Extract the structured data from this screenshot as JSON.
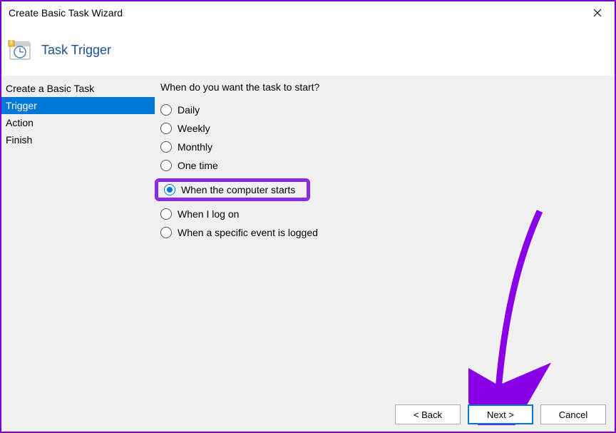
{
  "window": {
    "title": "Create Basic Task Wizard"
  },
  "header": {
    "title": "Task Trigger"
  },
  "sidebar": {
    "items": [
      {
        "label": "Create a Basic Task",
        "active": false
      },
      {
        "label": "Trigger",
        "active": true
      },
      {
        "label": "Action",
        "active": false
      },
      {
        "label": "Finish",
        "active": false
      }
    ]
  },
  "main": {
    "question": "When do you want the task to start?",
    "options": [
      {
        "label": "Daily",
        "checked": false
      },
      {
        "label": "Weekly",
        "checked": false
      },
      {
        "label": "Monthly",
        "checked": false
      },
      {
        "label": "One time",
        "checked": false
      },
      {
        "label": "When the computer starts",
        "checked": true,
        "highlighted": true
      },
      {
        "label": "When I log on",
        "checked": false
      },
      {
        "label": "When a specific event is logged",
        "checked": false
      }
    ]
  },
  "buttons": {
    "back": "< Back",
    "next": "Next >",
    "cancel": "Cancel"
  },
  "annotation": {
    "highlight_color": "#8a2be2",
    "arrow_color": "#8a00e6"
  }
}
